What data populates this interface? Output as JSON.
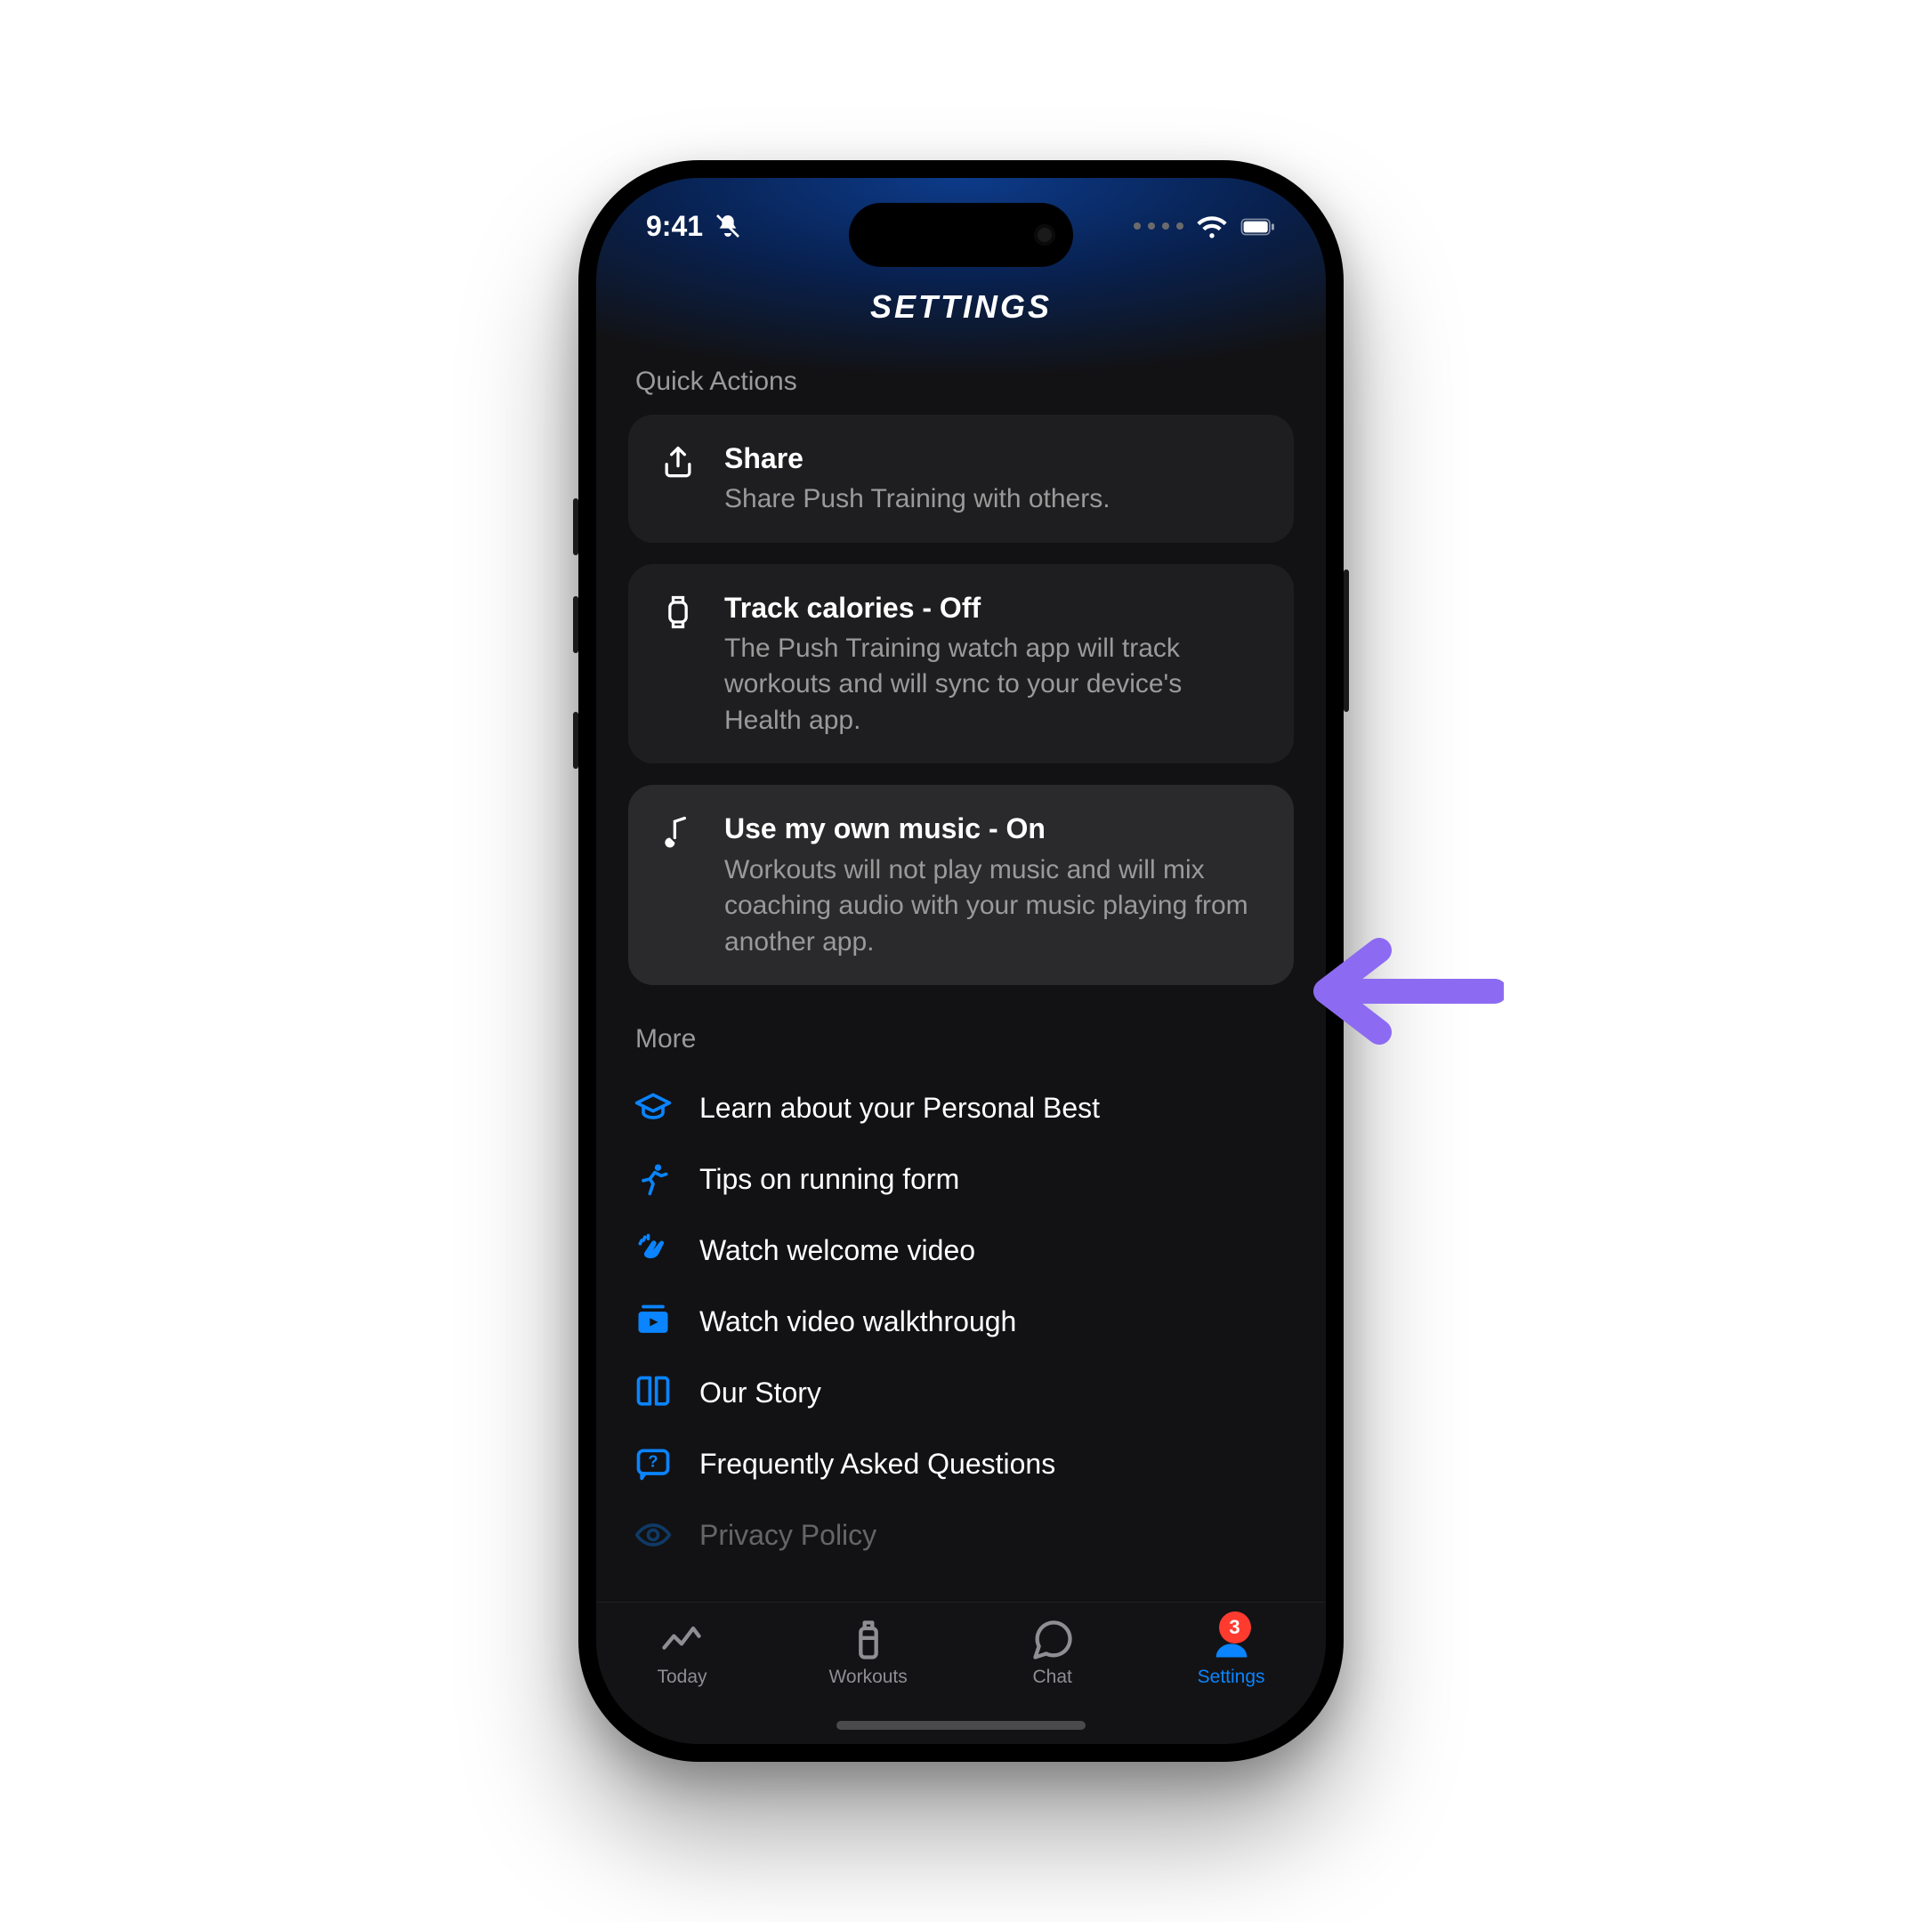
{
  "status": {
    "time": "9:41"
  },
  "header": {
    "title": "SETTINGS"
  },
  "quick_actions": {
    "label": "Quick Actions",
    "items": [
      {
        "title": "Share",
        "subtitle": "Share Push Training with others."
      },
      {
        "title": "Track calories - Off",
        "subtitle": "The Push Training watch app will track workouts and will sync to your device's Health app."
      },
      {
        "title": "Use my own music - On",
        "subtitle": "Workouts will not play music and will mix coaching audio with your music playing from another app."
      }
    ]
  },
  "more": {
    "label": "More",
    "items": [
      "Learn about your Personal Best",
      "Tips on running form",
      "Watch welcome video",
      "Watch video walkthrough",
      "Our Story",
      "Frequently Asked Questions",
      "Privacy Policy"
    ]
  },
  "tabbar": {
    "items": [
      {
        "label": "Today"
      },
      {
        "label": "Workouts"
      },
      {
        "label": "Chat"
      },
      {
        "label": "Settings",
        "badge": "3"
      }
    ]
  }
}
